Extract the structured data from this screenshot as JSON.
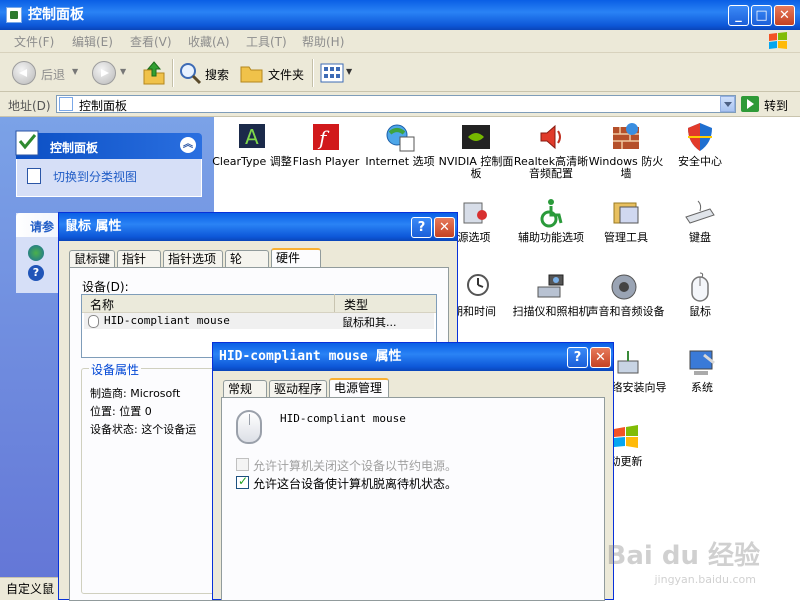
{
  "window": {
    "title": "控制面板"
  },
  "menu": [
    "文件(F)",
    "编辑(E)",
    "查看(V)",
    "收藏(A)",
    "工具(T)",
    "帮助(H)"
  ],
  "toolbar": {
    "back": "后退",
    "search": "搜索",
    "folders": "文件夹"
  },
  "address": {
    "label": "地址(D)",
    "value": "控制面板",
    "go": "转到"
  },
  "taskpane": {
    "header": "控制面板",
    "switch_view": "切换到分类视图",
    "section2_header": "请参"
  },
  "items": [
    {
      "label": "ClearType 调整",
      "icon": "cleartype-icon"
    },
    {
      "label": "Flash Player",
      "icon": "flash-icon"
    },
    {
      "label": "Internet 选项",
      "icon": "internet-icon"
    },
    {
      "label": "NVIDIA 控制面板",
      "icon": "nvidia-icon"
    },
    {
      "label": "Realtek高清晰音频配置",
      "icon": "realtek-icon"
    },
    {
      "label": "Windows 防火墙",
      "icon": "firewall-icon"
    },
    {
      "label": "安全中心",
      "icon": "shield-icon"
    },
    {
      "label": "源选项",
      "icon": "power-icon"
    },
    {
      "label": "辅助功能选项",
      "icon": "accessibility-icon"
    },
    {
      "label": "管理工具",
      "icon": "admin-tools-icon"
    },
    {
      "label": "键盘",
      "icon": "keyboard-icon"
    },
    {
      "label": "期和时间",
      "icon": "clock-icon"
    },
    {
      "label": "扫描仪和照相机",
      "icon": "scanner-icon"
    },
    {
      "label": "声音和音频设备",
      "icon": "speaker-icon"
    },
    {
      "label": "鼠标",
      "icon": "mouse-icon"
    },
    {
      "label": "线网络安装向导",
      "icon": "network-icon"
    },
    {
      "label": "系统",
      "icon": "system-icon"
    },
    {
      "label": "动更新",
      "icon": "update-icon"
    }
  ],
  "status": {
    "left": "自定义鼠"
  },
  "mouse_dialog": {
    "title": "鼠标 属性",
    "tabs": [
      "鼠标键",
      "指针",
      "指针选项",
      "轮",
      "硬件"
    ],
    "devices_label": "设备(D):",
    "columns": [
      "名称",
      "类型"
    ],
    "row": {
      "name": "HID-compliant mouse",
      "type": "鼠标和其..."
    },
    "props_label": "设备属性",
    "manufacturer": "制造商: Microsoft",
    "location": "位置: 位置 0",
    "status": "设备状态: 这个设备运"
  },
  "hid_dialog": {
    "title": "HID-compliant mouse 属性",
    "tabs": [
      "常规",
      "驱动程序",
      "电源管理"
    ],
    "device_name": "HID-compliant mouse",
    "opt1": "允许计算机关闭这个设备以节约电源。",
    "opt2": "允许这台设备使计算机脱离待机状态。"
  },
  "watermark": {
    "main": "Bai du 经验",
    "sub": "jingyan.baidu.com"
  }
}
